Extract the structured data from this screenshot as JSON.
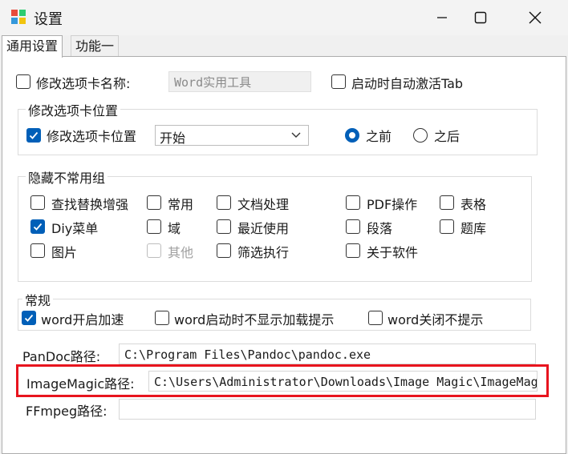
{
  "window": {
    "title": "设置"
  },
  "tabs": [
    "通用设置",
    "功能一"
  ],
  "rename_tab": {
    "label": "修改选项卡名称:",
    "value": "Word实用工具",
    "checked": false
  },
  "auto_activate": {
    "label": "启动时自动激活Tab",
    "checked": false
  },
  "position_group": {
    "title": "修改选项卡位置",
    "checkbox_label": "修改选项卡位置",
    "select_value": "开始",
    "radio_before": "之前",
    "radio_after": "之后",
    "selected": "之前"
  },
  "hidden_group": {
    "title": "隐藏不常用组",
    "items": [
      {
        "label": "查找替换增强",
        "checked": false,
        "enabled": true
      },
      {
        "label": "常用",
        "checked": false,
        "enabled": true
      },
      {
        "label": "文档处理",
        "checked": false,
        "enabled": true
      },
      {
        "label": "PDF操作",
        "checked": false,
        "enabled": true
      },
      {
        "label": "表格",
        "checked": false,
        "enabled": true
      },
      {
        "label": "Diy菜单",
        "checked": true,
        "enabled": true
      },
      {
        "label": "域",
        "checked": false,
        "enabled": true
      },
      {
        "label": "最近使用",
        "checked": false,
        "enabled": true
      },
      {
        "label": "段落",
        "checked": false,
        "enabled": true
      },
      {
        "label": "题库",
        "checked": false,
        "enabled": true
      },
      {
        "label": "图片",
        "checked": false,
        "enabled": true
      },
      {
        "label": "其他",
        "checked": false,
        "enabled": false
      },
      {
        "label": "筛选执行",
        "checked": false,
        "enabled": true
      },
      {
        "label": "关于软件",
        "checked": false,
        "enabled": true
      }
    ]
  },
  "general_group": {
    "title": "常规",
    "items": [
      {
        "label": "word开启加速",
        "checked": true
      },
      {
        "label": "word启动时不显示加载提示",
        "checked": false
      },
      {
        "label": "word关闭不提示",
        "checked": false
      }
    ]
  },
  "paths": {
    "pandoc": {
      "label": "PanDoc路径:",
      "value": "C:\\Program Files\\Pandoc\\pandoc.exe"
    },
    "imagemagic": {
      "label": "ImageMagic路径:",
      "value": "C:\\Users\\Administrator\\Downloads\\Image Magic\\ImageMagick"
    },
    "ffmpeg": {
      "label": "FFmpeg路径:",
      "value": ""
    }
  },
  "colors": {
    "accent": "#005fb8",
    "highlight": "#e8141e"
  }
}
